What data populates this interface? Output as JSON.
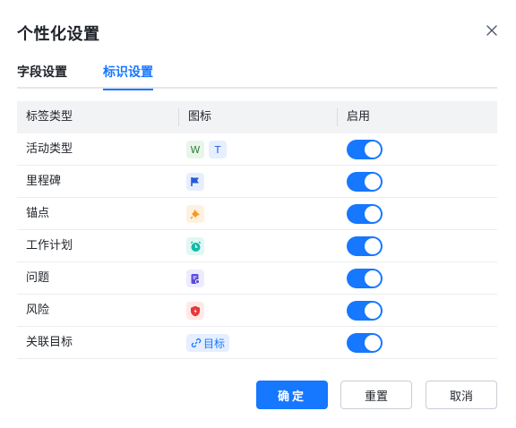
{
  "dialog": {
    "title": "个性化设置"
  },
  "tabs": [
    {
      "label": "字段设置",
      "active": false
    },
    {
      "label": "标识设置",
      "active": true
    }
  ],
  "table": {
    "headers": [
      "标签类型",
      "图标",
      "启用"
    ],
    "rows": [
      {
        "label": "活动类型",
        "icons": [
          "W",
          "T"
        ],
        "enabled": true
      },
      {
        "label": "里程碑",
        "icon": "flag-icon",
        "enabled": true
      },
      {
        "label": "锚点",
        "icon": "pin-icon",
        "enabled": true
      },
      {
        "label": "工作计划",
        "icon": "alarm-clock-icon",
        "enabled": true
      },
      {
        "label": "问题",
        "icon": "issue-doc-icon",
        "enabled": true
      },
      {
        "label": "风险",
        "icon": "risk-shield-icon",
        "enabled": true
      },
      {
        "label": "关联目标",
        "icon": "link-icon",
        "icon_text": "目标",
        "enabled": true
      }
    ]
  },
  "buttons": {
    "confirm": "确定",
    "reset": "重置",
    "cancel": "取消"
  },
  "colors": {
    "accent": "#1677ff",
    "header_bg": "#f2f3f5"
  }
}
